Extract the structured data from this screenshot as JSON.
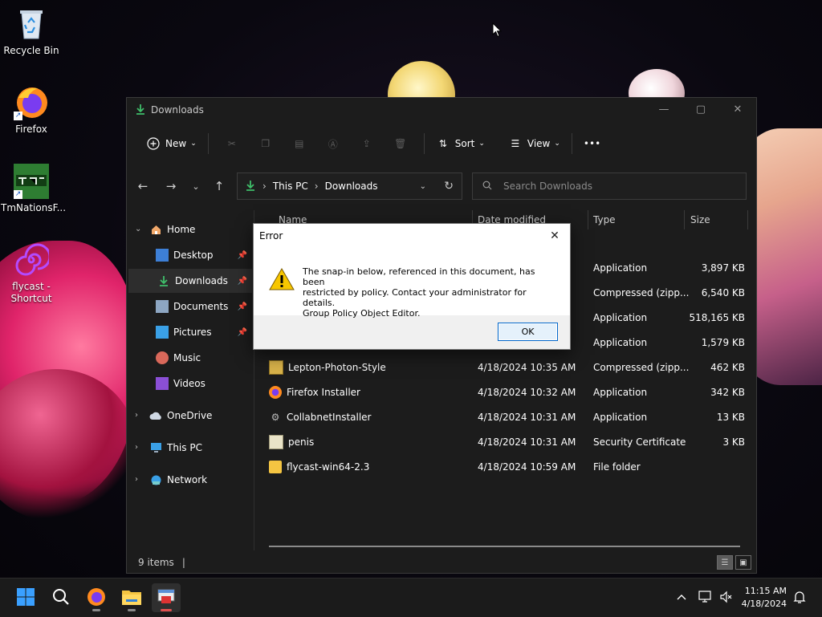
{
  "desktop": {
    "icons": [
      {
        "label": "Recycle Bin"
      },
      {
        "label": "Firefox"
      },
      {
        "label": "TmNationsF..."
      },
      {
        "label": "flycast -\nShortcut",
        "line1": "flycast -",
        "line2": "Shortcut"
      }
    ]
  },
  "explorer": {
    "title": "Downloads",
    "commandbar": {
      "new_label": "New",
      "sort_label": "Sort",
      "view_label": "View",
      "more_label": "•••"
    },
    "address": {
      "segment1": "This PC",
      "segment2": "Downloads",
      "separator": "›"
    },
    "search": {
      "placeholder": "Search Downloads"
    },
    "nav": {
      "home": "Home",
      "desktop": "Desktop",
      "downloads": "Downloads",
      "documents": "Documents",
      "pictures": "Pictures",
      "music": "Music",
      "videos": "Videos",
      "onedrive": "OneDrive",
      "thispc": "This PC",
      "network": "Network"
    },
    "columns": {
      "name": "Name",
      "date": "Date modified",
      "type": "Type",
      "size": "Size"
    },
    "rows": [
      {
        "name": "",
        "date": "",
        "type": "Application",
        "size": "3,897 KB"
      },
      {
        "name": "",
        "date": "",
        "type": "Compressed (zipp...",
        "size": "6,540 KB"
      },
      {
        "name": "",
        "date": "",
        "type": "Application",
        "size": "518,165 KB"
      },
      {
        "name": "",
        "date": "",
        "type": "Application",
        "size": "1,579 KB"
      },
      {
        "name": "Lepton-Photon-Style",
        "date": "4/18/2024 10:35 AM",
        "type": "Compressed (zipp...",
        "size": "462 KB"
      },
      {
        "name": "Firefox Installer",
        "date": "4/18/2024 10:32 AM",
        "type": "Application",
        "size": "342 KB"
      },
      {
        "name": "CollabnetInstaller",
        "date": "4/18/2024 10:31 AM",
        "type": "Application",
        "size": "13 KB"
      },
      {
        "name": "penis",
        "date": "4/18/2024 10:31 AM",
        "type": "Security Certificate",
        "size": "3 KB"
      },
      {
        "name": "flycast-win64-2.3",
        "date": "4/18/2024 10:59 AM",
        "type": "File folder",
        "size": ""
      }
    ],
    "status": {
      "items": "9 items"
    }
  },
  "dialog": {
    "title": "Error",
    "message_line1": "The snap-in below, referenced in this document, has been",
    "message_line2": "restricted by policy. Contact your administrator for details.",
    "message_line3": "Group Policy Object Editor.",
    "ok_label": "OK"
  },
  "taskbar": {
    "time": "11:15 AM",
    "date": "4/18/2024"
  },
  "colors": {
    "accent": "#0078d4",
    "download_green": "#3fbf6a",
    "folder_yellow": "#f5c542"
  }
}
